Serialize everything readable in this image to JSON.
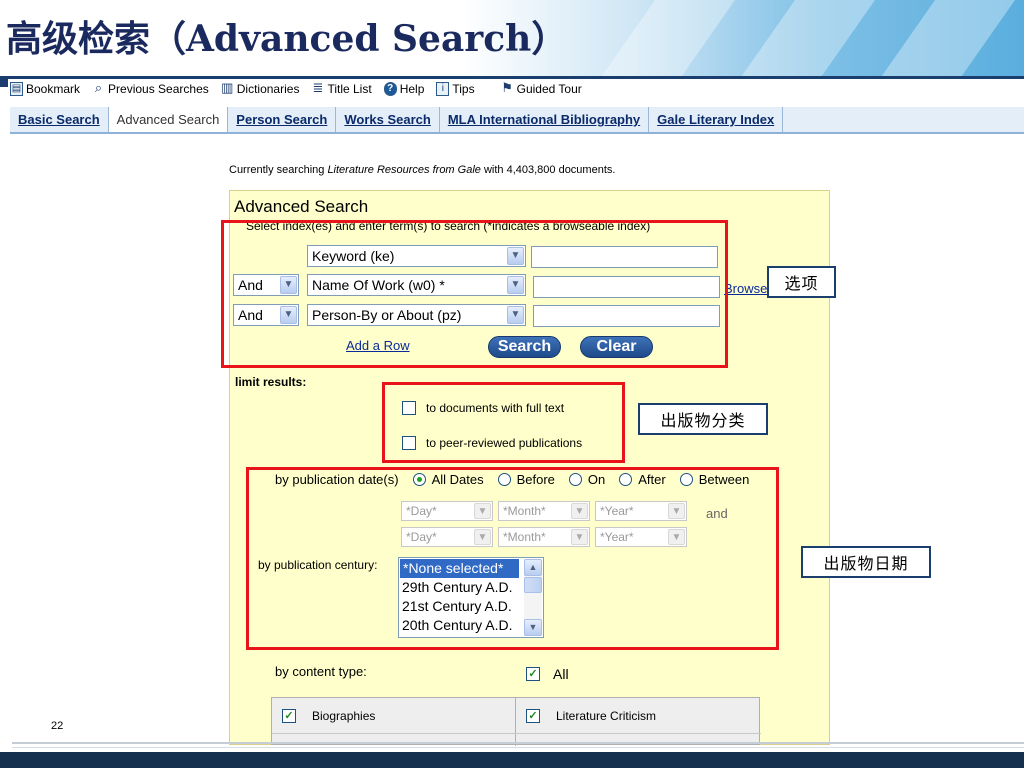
{
  "slide": {
    "title": "高级检索（Advanced Search）",
    "page_number": "22"
  },
  "toolbar": [
    {
      "label": "Bookmark",
      "icon": "bookmark-icon",
      "glyph": "▤"
    },
    {
      "label": "Previous Searches",
      "icon": "magnifier-icon",
      "glyph": "⌕"
    },
    {
      "label": "Dictionaries",
      "icon": "books-icon",
      "glyph": "▥"
    },
    {
      "label": "Title List",
      "icon": "list-icon",
      "glyph": "≣"
    },
    {
      "label": "Help",
      "icon": "help-icon",
      "glyph": "?"
    },
    {
      "label": "Tips",
      "icon": "tips-icon",
      "glyph": "i"
    },
    {
      "label": "Guided Tour",
      "icon": "walker-icon",
      "glyph": "⚑"
    }
  ],
  "tabs": [
    {
      "label": "Basic Search",
      "active": false
    },
    {
      "label": "Advanced Search",
      "active": true
    },
    {
      "label": "Person Search",
      "active": false
    },
    {
      "label": "Works Search",
      "active": false
    },
    {
      "label": "MLA International Bibliography",
      "active": false
    },
    {
      "label": "Gale Literary Index",
      "active": false
    }
  ],
  "context": {
    "prefix": "Currently searching ",
    "source": "Literature Resources from Gale",
    "middle": " with ",
    "count": "4,403,800",
    "suffix": " documents."
  },
  "search": {
    "heading": "Advanced Search",
    "instructions": "Select index(es) and enter term(s) to search (*indicates a browseable index)",
    "rows": [
      {
        "operator": null,
        "index": "Keyword (ke)",
        "term": ""
      },
      {
        "operator": "And",
        "index": "Name Of Work (w0) *",
        "term": ""
      },
      {
        "operator": "And",
        "index": "Person-By or About (pz)",
        "term": ""
      }
    ],
    "browse_link": "Browse",
    "add_row_link": "Add a Row",
    "search_button": "Search",
    "clear_button": "Clear"
  },
  "limits": {
    "label": "limit results:",
    "full_text": {
      "label": "to documents with full text",
      "checked": false
    },
    "peer_reviewed": {
      "label": "to peer-reviewed publications",
      "checked": false
    }
  },
  "pub_date": {
    "label": "by publication date(s)",
    "options": [
      {
        "label": "All Dates",
        "checked": true
      },
      {
        "label": "Before",
        "checked": false
      },
      {
        "label": "On",
        "checked": false
      },
      {
        "label": "After",
        "checked": false
      },
      {
        "label": "Between",
        "checked": false
      }
    ],
    "day_placeholder": "*Day*",
    "month_placeholder": "*Month*",
    "year_placeholder": "*Year*",
    "and_label": "and"
  },
  "century": {
    "label": "by publication century:",
    "options": [
      "*None selected*",
      "29th Century A.D.",
      "21st Century A.D.",
      "20th Century A.D."
    ],
    "selected": "*None selected*"
  },
  "content_type": {
    "label": "by content type:",
    "all": {
      "label": "All",
      "checked": true
    },
    "items": [
      {
        "label": "Biographies",
        "checked": true
      },
      {
        "label": "Literature Criticism",
        "checked": true
      }
    ]
  },
  "annotations": {
    "options_callout": "选项",
    "pub_type_callout": "出版物分类",
    "pub_date_callout": "出版物日期",
    "highlight_color": "#e8141a"
  }
}
